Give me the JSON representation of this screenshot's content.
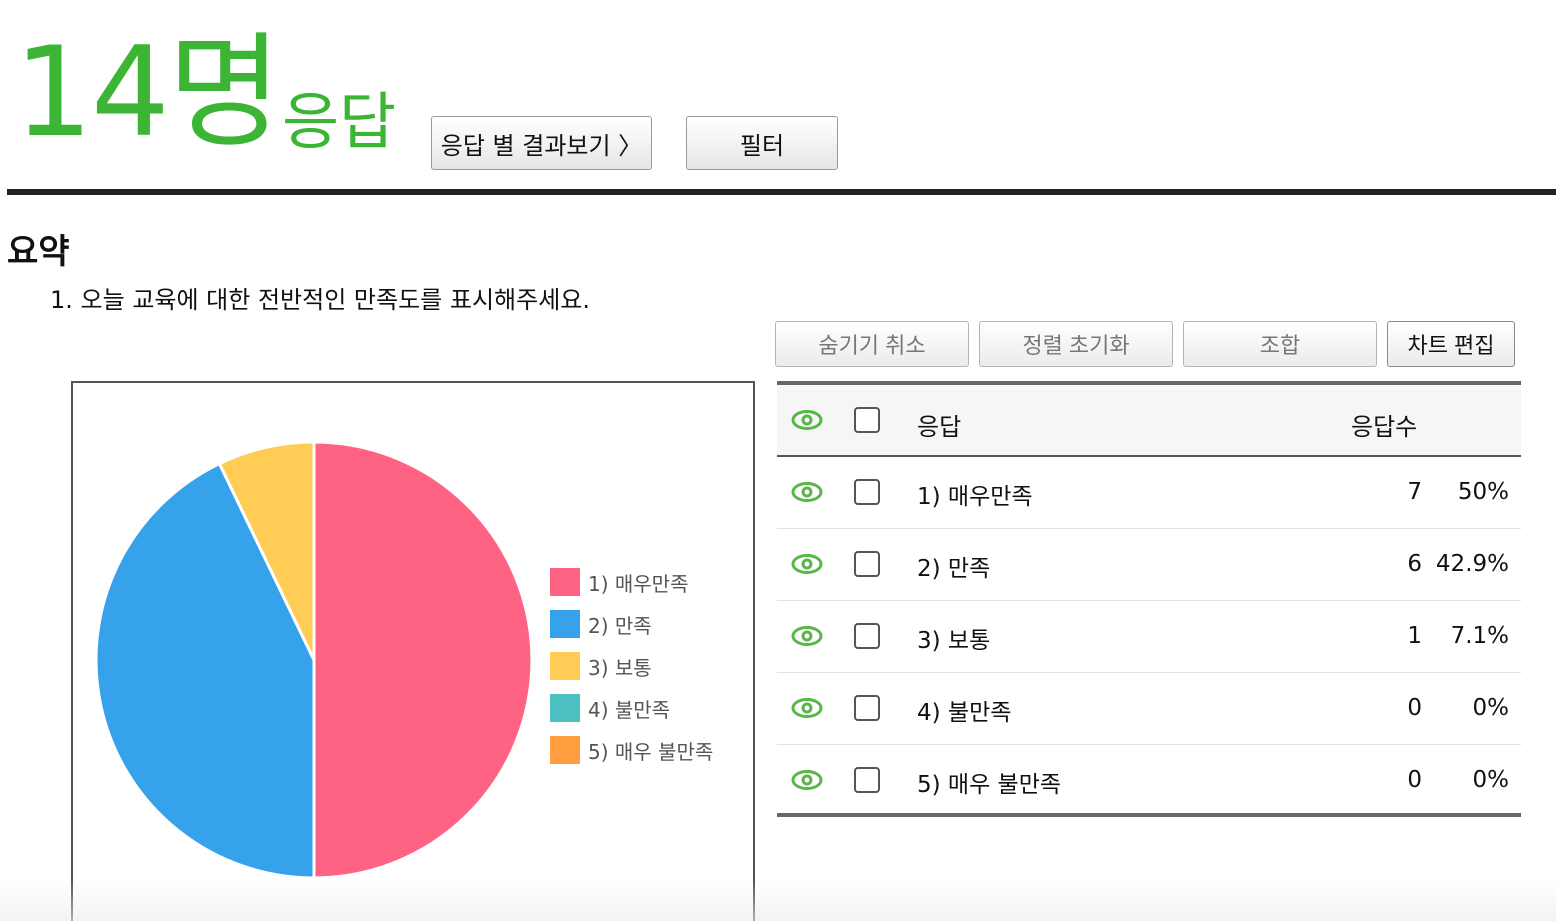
{
  "header": {
    "count": "14명",
    "count_suffix": "응답",
    "view_by_response_button": "응답 별 결과보기 〉",
    "filter_button": "필터"
  },
  "summary": {
    "title": "요약",
    "question": "1. 오늘 교육에 대한 전반적인 만족도를 표시해주세요."
  },
  "toolbar": {
    "unhide": "숨기기 취소",
    "reset_sort": "정렬 초기화",
    "combine": "조합",
    "edit_chart": "차트 편집"
  },
  "table": {
    "header_response": "응답",
    "header_count": "응답수",
    "rows": [
      {
        "label": "1) 매우만족",
        "count": "7",
        "pct": "50%"
      },
      {
        "label": "2) 만족",
        "count": "6",
        "pct": "42.9%"
      },
      {
        "label": "3) 보통",
        "count": "1",
        "pct": "7.1%"
      },
      {
        "label": "4) 불만족",
        "count": "0",
        "pct": "0%"
      },
      {
        "label": "5) 매우 불만족",
        "count": "0",
        "pct": "0%"
      }
    ]
  },
  "colors": {
    "accent_green": "#3cb534",
    "eye_green": "#5ab54b"
  },
  "chart_data": {
    "type": "pie",
    "categories": [
      "1) 매우만족",
      "2) 만족",
      "3) 보통",
      "4) 불만족",
      "5) 매우 불만족"
    ],
    "values": [
      7,
      6,
      1,
      0,
      0
    ],
    "colors": [
      "#ff6384",
      "#36a2eb",
      "#ffcd56",
      "#4bc0c0",
      "#ff9f40"
    ],
    "legend_position": "right"
  }
}
